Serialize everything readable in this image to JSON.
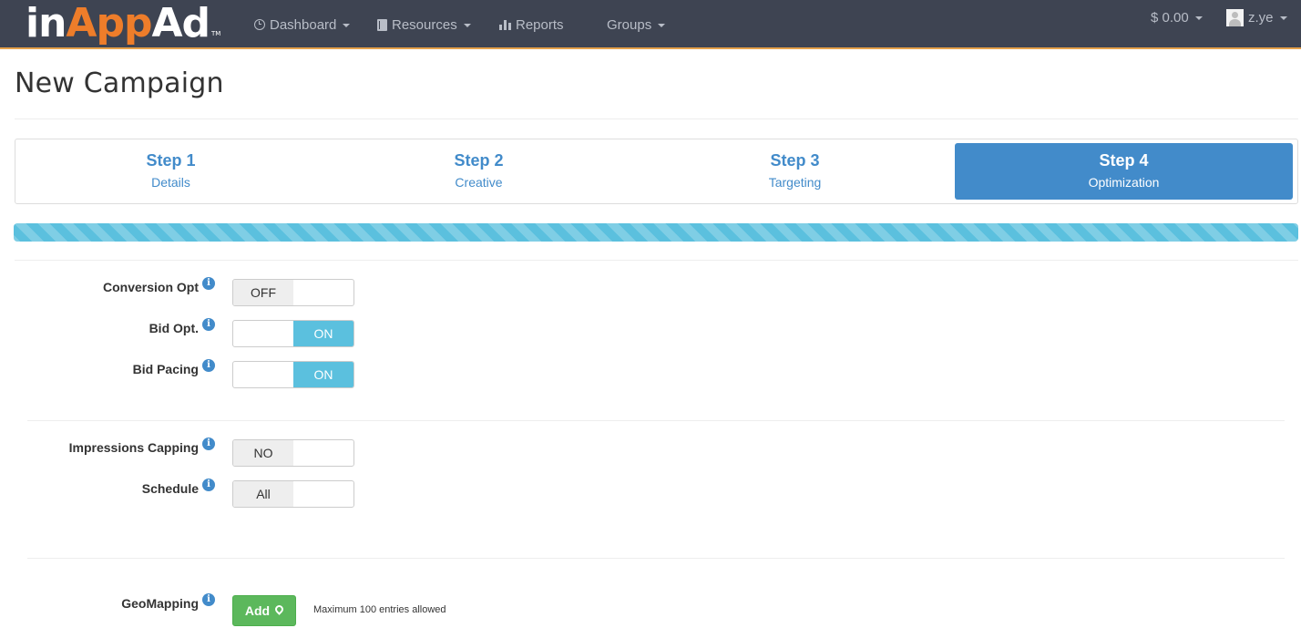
{
  "navbar": {
    "logo_part1": "in",
    "logo_part2": "App",
    "logo_part3": "Ad",
    "logo_tm": "TM",
    "items": [
      {
        "label": "Dashboard",
        "icon": "clock-icon"
      },
      {
        "label": "Resources",
        "icon": "book-icon"
      },
      {
        "label": "Reports",
        "icon": "bar-chart-icon"
      },
      {
        "label": "Groups",
        "icon": "grid-icon"
      }
    ],
    "balance": "$ 0.00",
    "user": "z.ye"
  },
  "page": {
    "title": "New Campaign"
  },
  "steps": [
    {
      "title": "Step 1",
      "subtitle": "Details"
    },
    {
      "title": "Step 2",
      "subtitle": "Creative"
    },
    {
      "title": "Step 3",
      "subtitle": "Targeting"
    },
    {
      "title": "Step 4",
      "subtitle": "Optimization"
    }
  ],
  "progress": {
    "percent": 100
  },
  "form": {
    "conversion_opt": {
      "label": "Conversion Opt",
      "value": "OFF"
    },
    "bid_opt": {
      "label": "Bid Opt.",
      "value": "ON"
    },
    "bid_pacing": {
      "label": "Bid Pacing",
      "value": "ON"
    },
    "impressions_capping": {
      "label": "Impressions Capping",
      "value": "NO"
    },
    "schedule": {
      "label": "Schedule",
      "value": "All"
    },
    "geomapping": {
      "label": "GeoMapping",
      "button": "Add",
      "help": "Maximum 100 entries allowed"
    }
  },
  "colors": {
    "navbar": "#3e4452",
    "brand_orange": "#ee7d2a",
    "primary": "#428bca",
    "info": "#5bc0de",
    "success": "#5cb85c"
  }
}
